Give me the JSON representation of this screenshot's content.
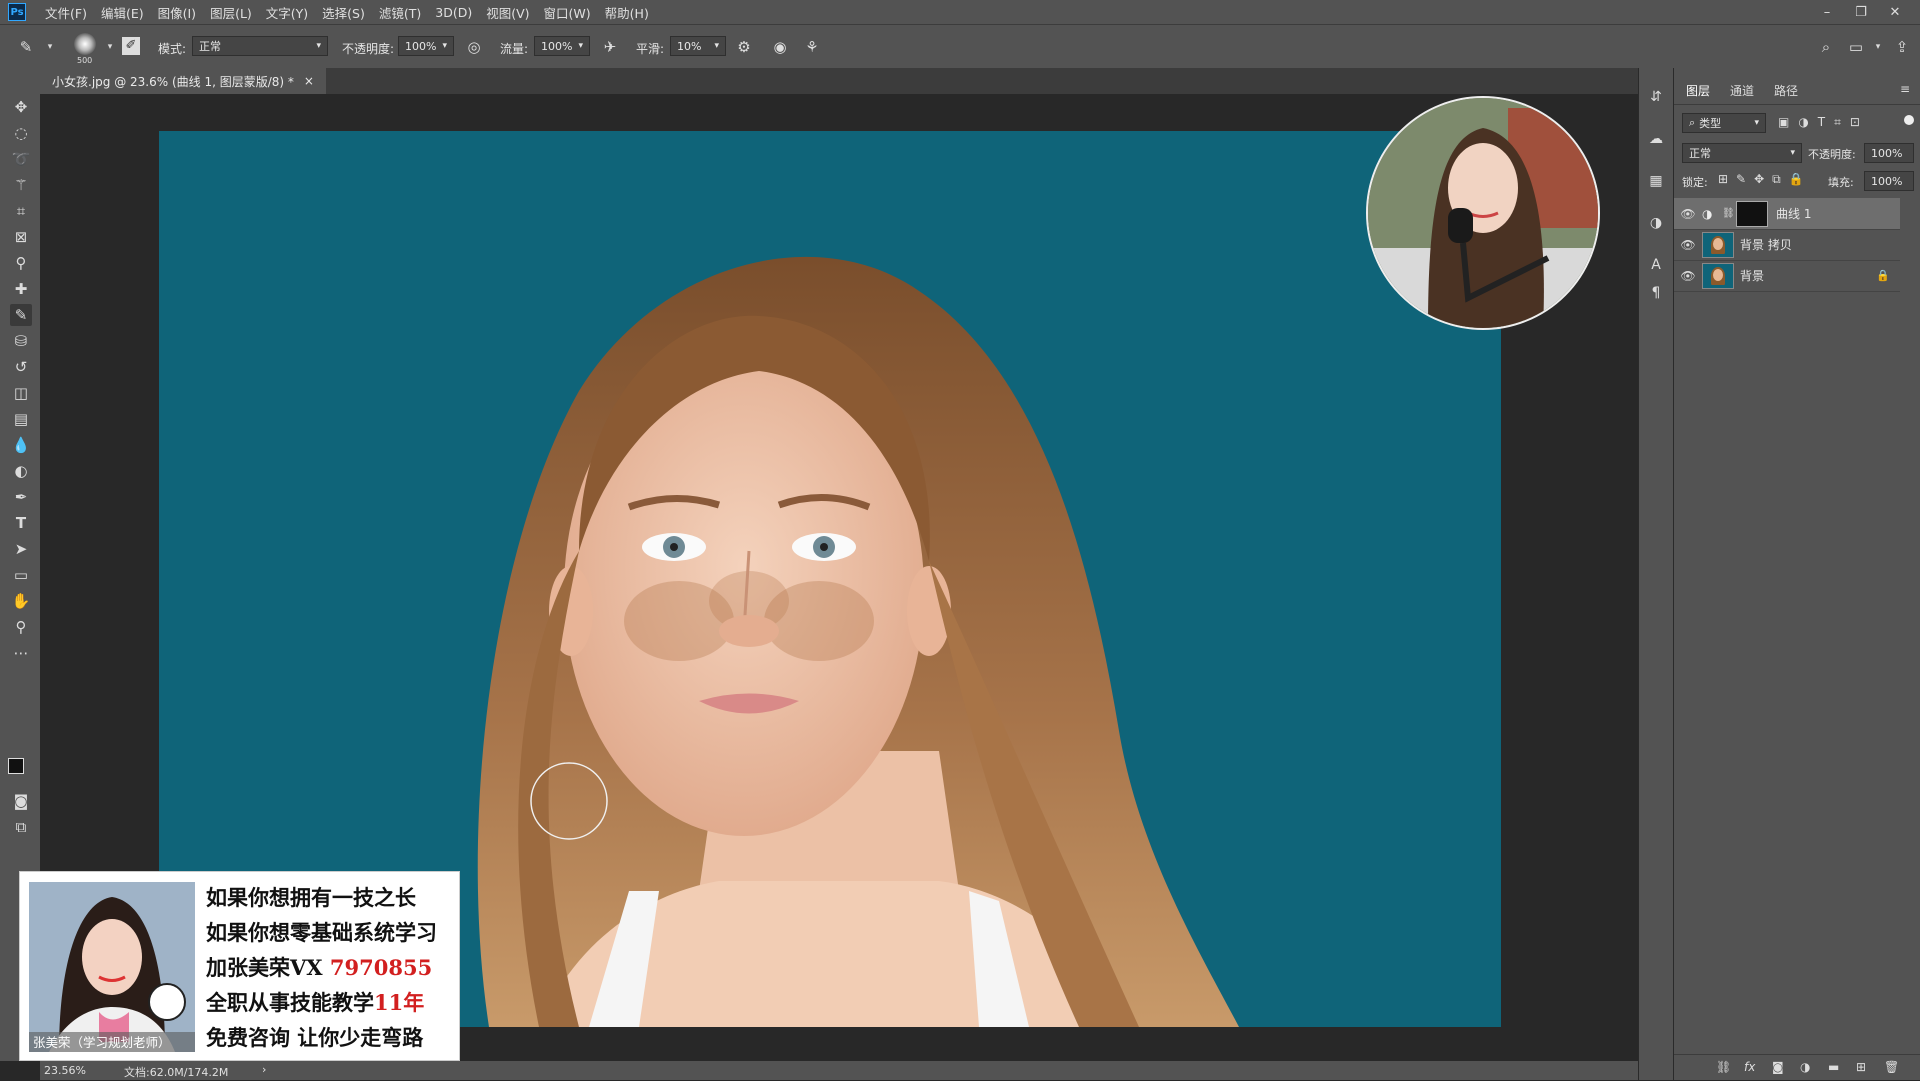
{
  "menubar": {
    "logo": "Ps",
    "items": [
      "文件(F)",
      "编辑(E)",
      "图像(I)",
      "图层(L)",
      "文字(Y)",
      "选择(S)",
      "滤镜(T)",
      "3D(D)",
      "视图(V)",
      "窗口(W)",
      "帮助(H)"
    ],
    "controls": [
      "–",
      "❐",
      "✕"
    ]
  },
  "options": {
    "brush_size": "500",
    "mode_label": "模式:",
    "mode_value": "正常",
    "opacity_label": "不透明度:",
    "opacity_value": "100%",
    "flow_label": "流量:",
    "flow_value": "100%",
    "smoothing_label": "平滑:",
    "smoothing_value": "10%"
  },
  "document": {
    "tab_title": "小女孩.jpg @ 23.6% (曲线 1, 图层蒙版/8) *",
    "close": "×"
  },
  "status": {
    "zoom": "23.56%",
    "doc_size": "文档:62.0M/174.2M",
    "arrow": "›"
  },
  "layers_panel": {
    "tabs": [
      "图层",
      "通道",
      "路径"
    ],
    "filter_kind": "类型",
    "blend_mode": "正常",
    "opacity_label": "不透明度:",
    "opacity_value": "100%",
    "lock_label": "锁定:",
    "fill_label": "填充:",
    "fill_value": "100%",
    "layers": [
      {
        "name": "曲线 1",
        "selected": true
      },
      {
        "name": "背景 拷贝",
        "selected": false
      },
      {
        "name": "背景",
        "selected": false
      }
    ],
    "bottom_icons": [
      "link-icon",
      "fx-icon",
      "mask-icon",
      "adjustment-icon",
      "group-icon",
      "new-layer-icon",
      "trash-icon"
    ]
  },
  "promo": {
    "name_caption": "张美荣（学习规划老师）",
    "line1": "如果你想拥有一技之长",
    "line2": "如果你想零基础系统学习",
    "line3_prefix": "加张美荣VX ",
    "line3_red": "7970855",
    "line4_prefix": "全职从事技能教学",
    "line4_red": "11年",
    "line5": "免费咨询 让你少走弯路"
  },
  "colors": {
    "canvas_bg": "#0f6479",
    "panel_bg": "#535353",
    "accent_red": "#d21f1f"
  }
}
